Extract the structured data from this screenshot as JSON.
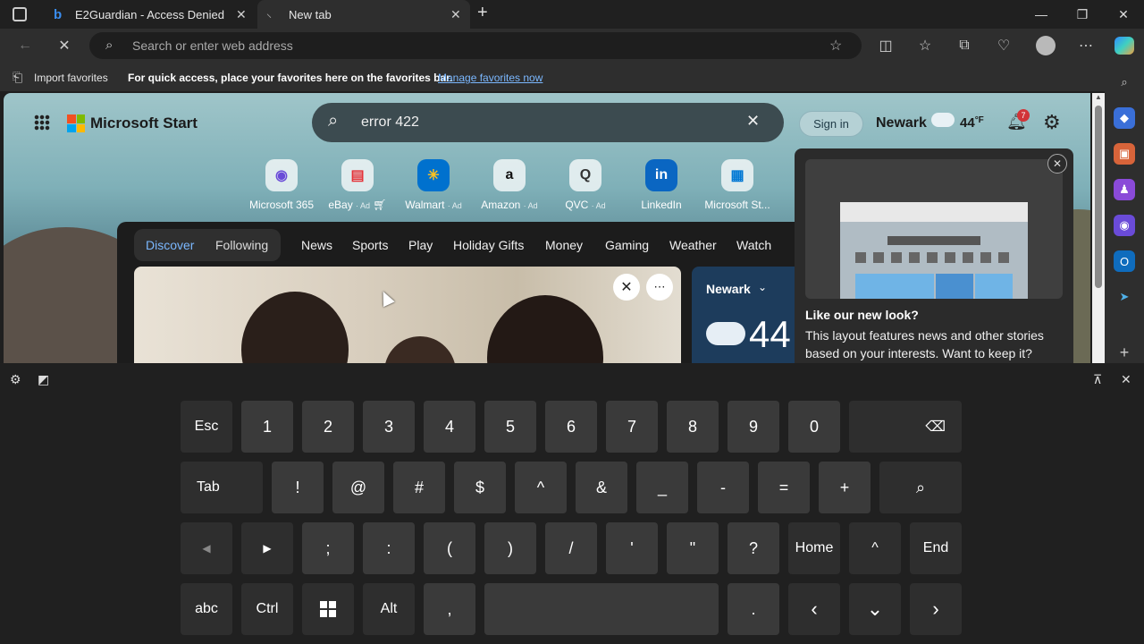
{
  "tabs": [
    {
      "title": "E2Guardian - Access Denied",
      "icon": "bing-icon"
    },
    {
      "title": "New tab",
      "icon": "loading-icon"
    }
  ],
  "address_bar": {
    "placeholder": "Search or enter web address"
  },
  "favorites_bar": {
    "import_label": "Import favorites",
    "hint": "For quick access, place your favorites here on the favorites bar.",
    "manage_link": "Manage favorites now"
  },
  "msstart": {
    "brand": "Microsoft Start",
    "search_value": "error 422",
    "sign_in": "Sign in",
    "location": "Newark",
    "temp": "44",
    "unit": "°F",
    "notification_count": "7",
    "quick_links": [
      {
        "label": "Microsoft 365",
        "ad": "",
        "icon": "microsoft-365-icon"
      },
      {
        "label": "eBay",
        "ad": "· Ad",
        "icon": "ebay-icon"
      },
      {
        "label": "Walmart",
        "ad": "· Ad",
        "icon": "walmart-icon"
      },
      {
        "label": "Amazon",
        "ad": "· Ad",
        "icon": "amazon-icon"
      },
      {
        "label": "QVC",
        "ad": "· Ad",
        "icon": "qvc-icon"
      },
      {
        "label": "LinkedIn",
        "ad": "",
        "icon": "linkedin-icon"
      },
      {
        "label": "Microsoft St...",
        "ad": "",
        "icon": "microsoft-store-icon"
      }
    ],
    "feed_tabs": {
      "discover": "Discover",
      "following": "Following"
    },
    "feed_nav": [
      "News",
      "Sports",
      "Play",
      "Holiday Gifts",
      "Money",
      "Gaming",
      "Weather",
      "Watch"
    ],
    "weather_card": {
      "location": "Newark",
      "temp": "44"
    },
    "popup": {
      "title": "Like our new look?",
      "body": "This layout features news and other stories based on your interests. Want to keep it?"
    }
  },
  "keyboard": {
    "row1": [
      "Esc",
      "1",
      "2",
      "3",
      "4",
      "5",
      "6",
      "7",
      "8",
      "9",
      "0",
      "⌫"
    ],
    "row2": [
      "Tab",
      "!",
      "@",
      "#",
      "$",
      "^",
      "&",
      "_",
      "-",
      "=",
      "+",
      "🔍"
    ],
    "row3": [
      "◀",
      "▶",
      ";",
      ":",
      "(",
      ")",
      "/",
      "'",
      "\"",
      "?",
      "Home",
      "^",
      "End"
    ],
    "row4": [
      "abc",
      "Ctrl",
      "⊞",
      "Alt",
      ",",
      "",
      ".",
      "‹",
      "⌄",
      "›"
    ]
  },
  "colors": {
    "accent": "#7bb8ff",
    "badge": "#d13438",
    "link": "#7bb8ff"
  }
}
